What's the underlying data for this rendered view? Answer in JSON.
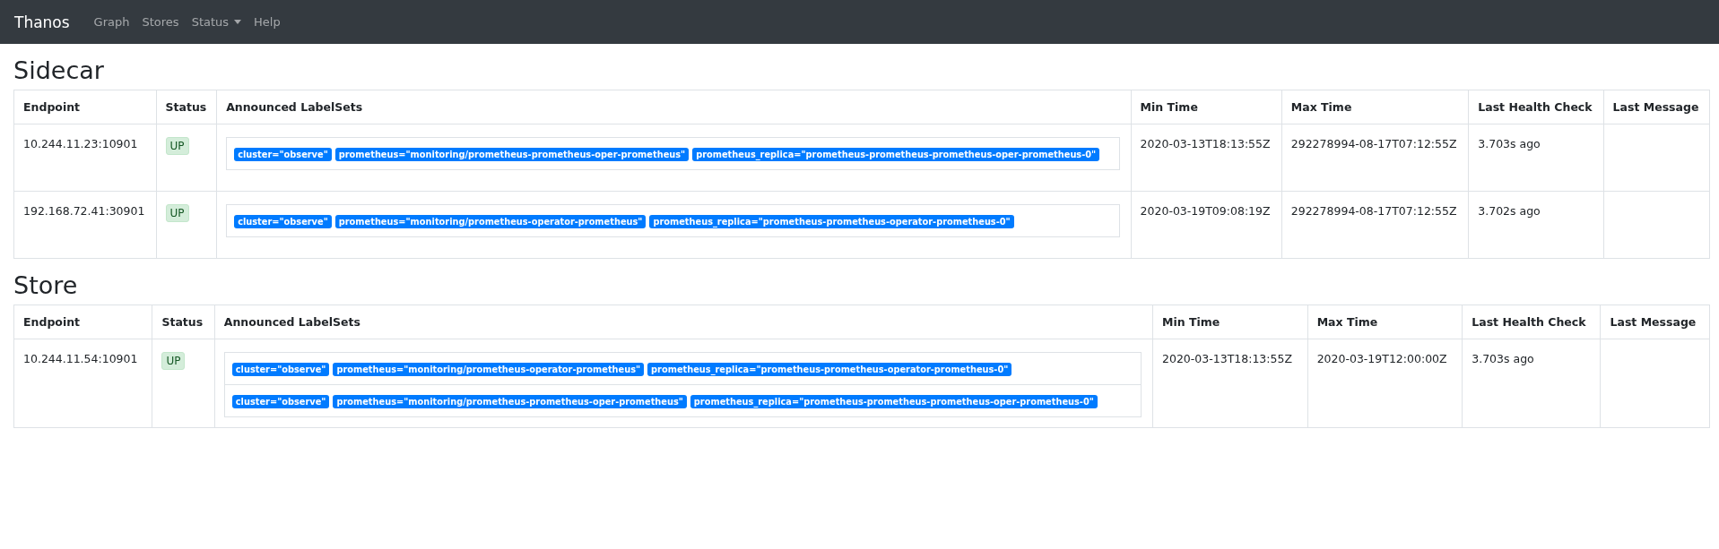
{
  "navbar": {
    "brand": "Thanos",
    "items": [
      {
        "label": "Graph",
        "dropdown": false
      },
      {
        "label": "Stores",
        "dropdown": false
      },
      {
        "label": "Status",
        "dropdown": true
      },
      {
        "label": "Help",
        "dropdown": false
      }
    ]
  },
  "sections": [
    {
      "title": "Sidecar",
      "columns": [
        "Endpoint",
        "Status",
        "Announced LabelSets",
        "Min Time",
        "Max Time",
        "Last Health Check",
        "Last Message"
      ],
      "rows": [
        {
          "endpoint": "10.244.11.23:10901",
          "status": "UP",
          "healthy": true,
          "labelsets": [
            [
              "cluster=\"observe\"",
              "prometheus=\"monitoring/prometheus-prometheus-oper-prometheus\"",
              "prometheus_replica=\"prometheus-prometheus-prometheus-oper-prometheus-0\""
            ]
          ],
          "min_time": "2020-03-13T18:13:55Z",
          "max_time": "292278994-08-17T07:12:55Z",
          "last_health_check": "3.703s ago"
        },
        {
          "endpoint": "192.168.72.41:30901",
          "status": "UP",
          "healthy": true,
          "labelsets": [
            [
              "cluster=\"observe\"",
              "prometheus=\"monitoring/prometheus-operator-prometheus\"",
              "prometheus_replica=\"prometheus-prometheus-operator-prometheus-0\""
            ]
          ],
          "min_time": "2020-03-19T09:08:19Z",
          "max_time": "292278994-08-17T07:12:55Z",
          "last_health_check": "3.702s ago"
        }
      ]
    },
    {
      "title": "Store",
      "columns": [
        "Endpoint",
        "Status",
        "Announced LabelSets",
        "Min Time",
        "Max Time",
        "Last Health Check",
        "Last Message"
      ],
      "rows": [
        {
          "endpoint": "10.244.11.54:10901",
          "status": "UP",
          "healthy": true,
          "labelsets": [
            [
              "cluster=\"observe\"",
              "prometheus=\"monitoring/prometheus-operator-prometheus\"",
              "prometheus_replica=\"prometheus-prometheus-operator-prometheus-0\""
            ],
            [
              "cluster=\"observe\"",
              "prometheus=\"monitoring/prometheus-prometheus-oper-prometheus\"",
              "prometheus_replica=\"prometheus-prometheus-prometheus-oper-prometheus-0\""
            ]
          ],
          "min_time": "2020-03-13T18:13:55Z",
          "max_time": "2020-03-19T12:00:00Z",
          "last_health_check": "3.703s ago"
        }
      ]
    }
  ]
}
